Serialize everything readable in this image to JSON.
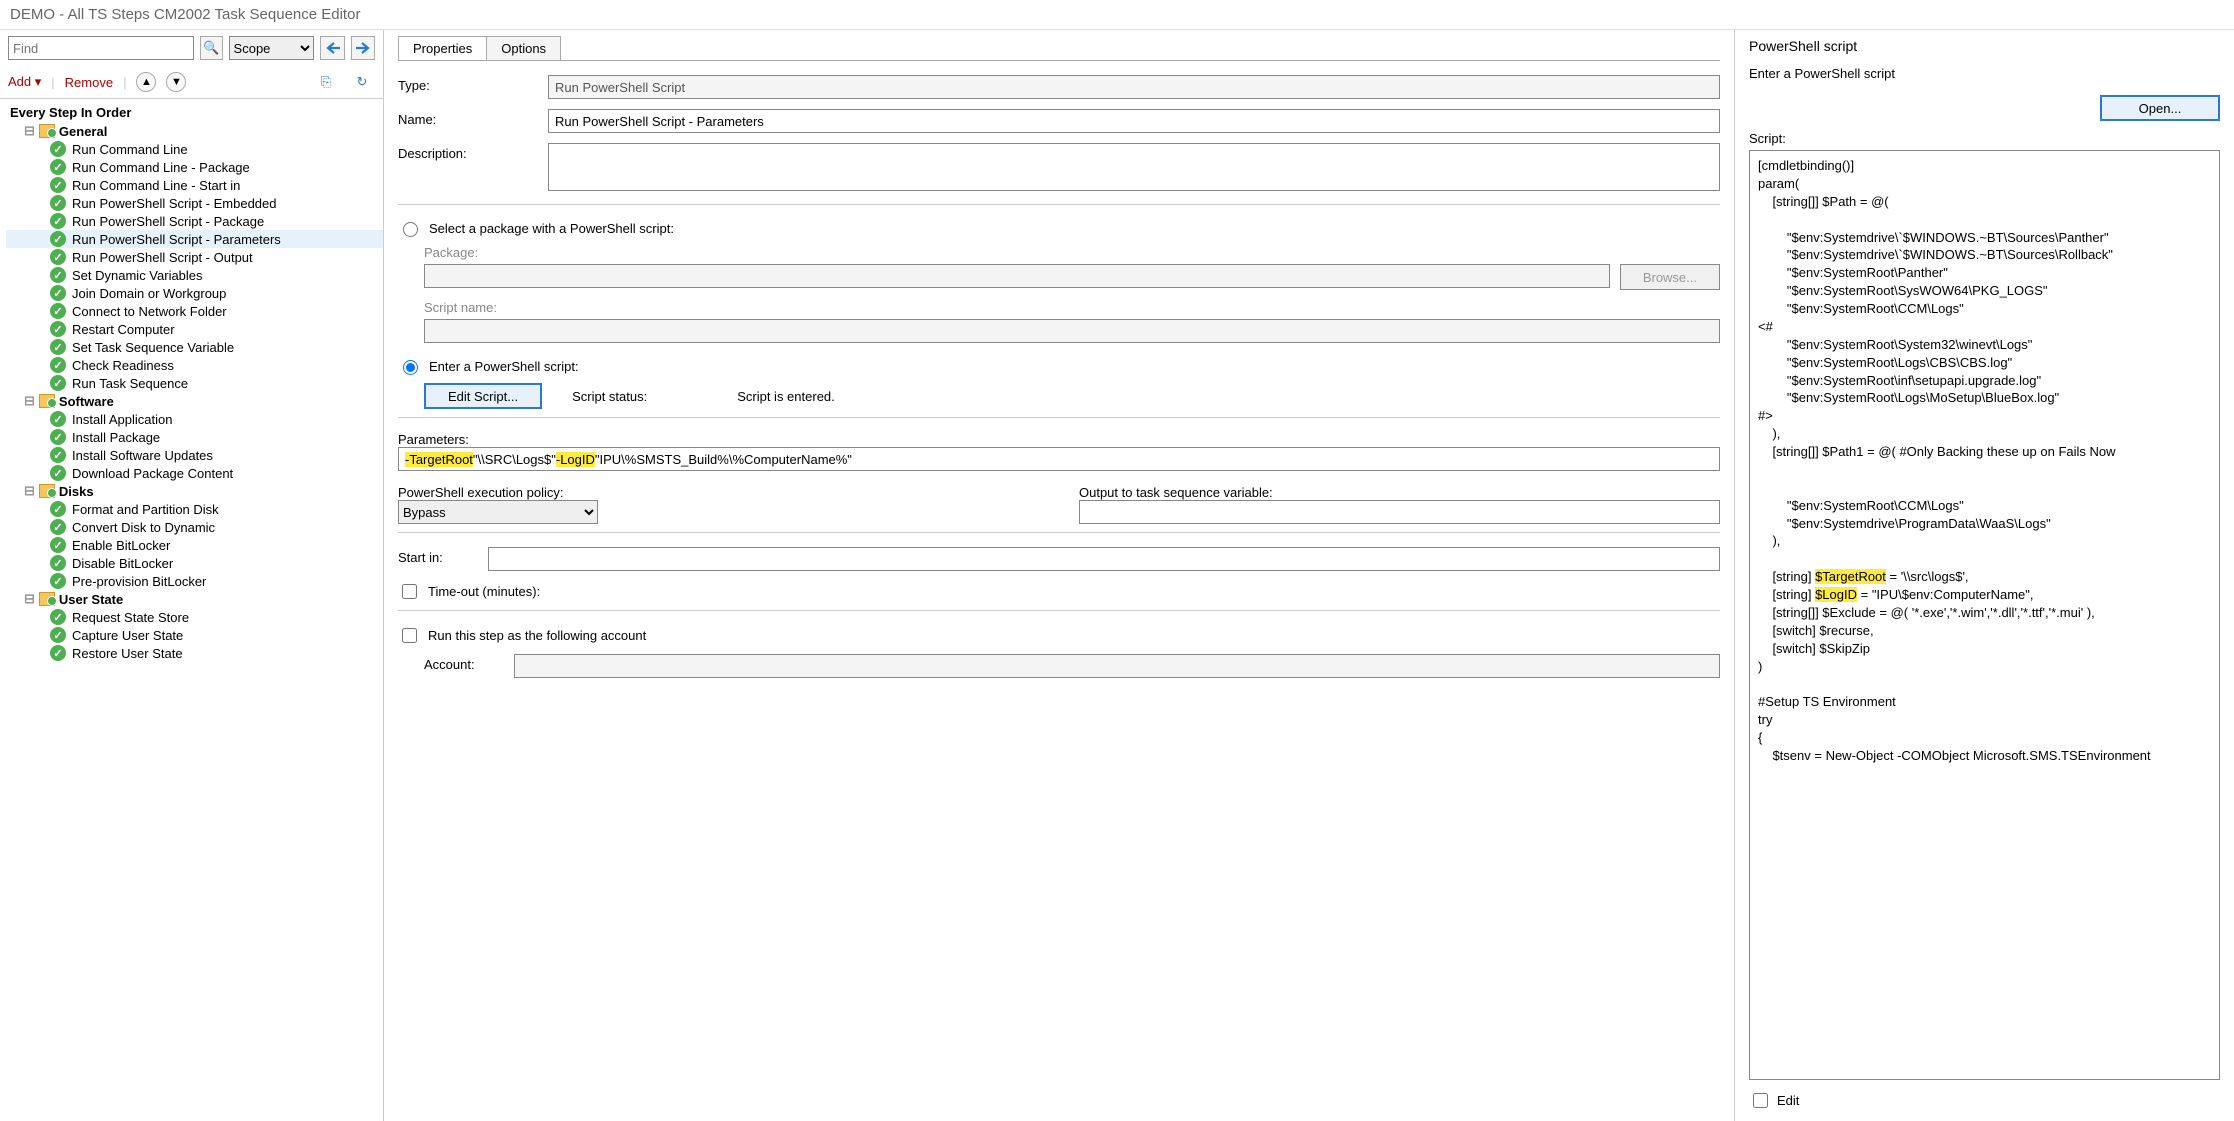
{
  "title": "DEMO - All TS Steps CM2002 Task Sequence Editor",
  "find_placeholder": "Find",
  "scope_value": "Scope",
  "toolbar": {
    "add": "Add",
    "remove": "Remove"
  },
  "tree": {
    "root": "Every Step In Order",
    "groups": [
      {
        "label": "General",
        "items": [
          "Run Command Line",
          "Run Command Line - Package",
          "Run Command Line - Start in",
          "Run PowerShell Script - Embedded",
          "Run PowerShell Script - Package",
          "Run PowerShell Script - Parameters",
          "Run PowerShell Script - Output",
          "Set Dynamic Variables",
          "Join Domain or Workgroup",
          "Connect to Network Folder",
          "Restart Computer",
          "Set Task Sequence Variable",
          "Check Readiness",
          "Run Task Sequence"
        ]
      },
      {
        "label": "Software",
        "items": [
          "Install Application",
          "Install Package",
          "Install Software Updates",
          "Download Package Content"
        ]
      },
      {
        "label": "Disks",
        "items": [
          "Format and Partition Disk",
          "Convert Disk to Dynamic",
          "Enable BitLocker",
          "Disable BitLocker",
          "Pre-provision BitLocker"
        ]
      },
      {
        "label": "User State",
        "items": [
          "Request State Store",
          "Capture User State",
          "Restore User State"
        ]
      }
    ],
    "selected": "Run PowerShell Script - Parameters"
  },
  "tabs": {
    "properties": "Properties",
    "options": "Options"
  },
  "form": {
    "type_label": "Type:",
    "type_value": "Run PowerShell Script",
    "name_label": "Name:",
    "name_value": "Run PowerShell Script - Parameters",
    "desc_label": "Description:",
    "desc_value": "",
    "radio_pkg": "Select a package with a PowerShell script:",
    "pkg_label": "Package:",
    "browse": "Browse...",
    "scriptname_label": "Script name:",
    "radio_enter": "Enter a PowerShell script:",
    "edit_script": "Edit Script...",
    "status_label": "Script status:",
    "status_value": "Script is entered.",
    "params_label": "Parameters:",
    "param_pre": "-TargetRoot",
    "param_mid1": " \"\\\\SRC\\Logs$\" ",
    "param_hl2": "-LogID",
    "param_mid2": " \"IPU\\%SMSTS_Build%\\%ComputerName%\"",
    "policy_label": "PowerShell execution policy:",
    "policy_value": "Bypass",
    "output_label": "Output to task sequence variable:",
    "startin_label": "Start in:",
    "timeout_label": "Time-out (minutes):",
    "runas_label": "Run this step as the following account",
    "account_label": "Account:"
  },
  "right": {
    "title": "PowerShell script",
    "subtitle": "Enter a PowerShell script",
    "open": "Open...",
    "script_label": "Script:",
    "edit_label": "Edit",
    "script_pre": "[cmdletbinding()]\nparam(\n    [string[]] $Path = @(\n\n        \"$env:Systemdrive\\`$WINDOWS.~BT\\Sources\\Panther\"\n        \"$env:Systemdrive\\`$WINDOWS.~BT\\Sources\\Rollback\"\n        \"$env:SystemRoot\\Panther\"\n        \"$env:SystemRoot\\SysWOW64\\PKG_LOGS\"\n        \"$env:SystemRoot\\CCM\\Logs\"\n<#\n        \"$env:SystemRoot\\System32\\winevt\\Logs\"\n        \"$env:SystemRoot\\Logs\\CBS\\CBS.log\"\n        \"$env:SystemRoot\\inf\\setupapi.upgrade.log\"\n        \"$env:SystemRoot\\Logs\\MoSetup\\BlueBox.log\"\n#>\n    ),\n    [string[]] $Path1 = @( #Only Backing these up on Fails Now\n\n\n        \"$env:SystemRoot\\CCM\\Logs\"\n        \"$env:Systemdrive\\ProgramData\\WaaS\\Logs\"\n    ),\n\n    [string] ",
    "script_hl1": "$TargetRoot",
    "script_mid1": " = '\\\\src\\logs$',\n    [string] ",
    "script_hl2": "$LogID",
    "script_post": " = \"IPU\\$env:ComputerName\",\n    [string[]] $Exclude = @( '*.exe','*.wim','*.dll','*.ttf','*.mui' ),\n    [switch] $recurse,\n    [switch] $SkipZip\n)\n\n#Setup TS Environment\ntry\n{\n    $tsenv = New-Object -COMObject Microsoft.SMS.TSEnvironment"
  }
}
